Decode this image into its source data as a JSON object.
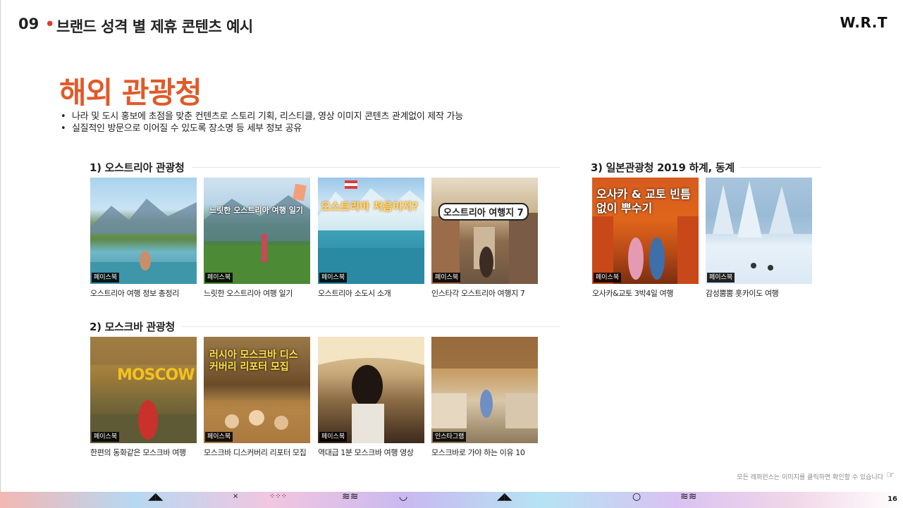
{
  "header": {
    "number": "09",
    "dot": "•",
    "title": "브랜드 성격 별 제휴 콘텐츠 예시",
    "logo": "W.R.T"
  },
  "main": {
    "title": "해외 관광청",
    "bullets": [
      "나라 및 도시 홍보에 초점을 맞춘 컨텐츠로 스토리 기획, 리스티클, 영상 이미지 콘텐츠 관계없이 제작 가능",
      "실질적인 방문으로 이어질 수 있도록 장소명 등 세부 정보 공유"
    ]
  },
  "sections": [
    {
      "title": "1) 오스트리아 관광청",
      "cards": [
        {
          "tag": "페이스북",
          "caption": "오스트리아 여행 정보 총정리",
          "overlay": ""
        },
        {
          "tag": "페이스북",
          "caption": "느릿한 오스트리아 여행 일기",
          "overlay": "느릿한 오스트리아 여행 일기"
        },
        {
          "tag": "페이스북",
          "caption": "오스트리아 소도시 소개",
          "overlay": "오스트리아 처음이지?"
        },
        {
          "tag": "페이스북",
          "caption": "인스타각 오스트리아 여행지 7",
          "overlay": "오스트리아 여행지 7"
        }
      ]
    },
    {
      "title": "2) 모스크바 관광청",
      "cards": [
        {
          "tag": "페이스북",
          "caption": "한편의 동화같은 모스크바 여행",
          "overlay": "MOSCOW"
        },
        {
          "tag": "페이스북",
          "caption": "모스크바 디스커버리 리포터 모집",
          "overlay": "러시아 모스크바 디스커버리 리포터 모집"
        },
        {
          "tag": "페이스북",
          "caption": "역대급 1분 모스크바 여행 영상",
          "overlay": ""
        },
        {
          "tag": "인스타그램",
          "caption": "모스크바로 가야 하는 이유 10",
          "overlay": ""
        }
      ]
    },
    {
      "title": "3) 일본관광청 2019 하계, 동계",
      "cards": [
        {
          "tag": "페이스북",
          "caption": "오사카&교토 3박4일 여행",
          "overlay": "오사카 & 교토 빈틈 없이 뿌수기"
        },
        {
          "tag": "페이스북",
          "caption": "감성뿜뿜 홋카이도 여행",
          "overlay": ""
        }
      ]
    }
  ],
  "footer": {
    "note": "모든 레퍼런스는 이미지를 클릭하면 확인할 수 있습니다",
    "page": "16"
  }
}
